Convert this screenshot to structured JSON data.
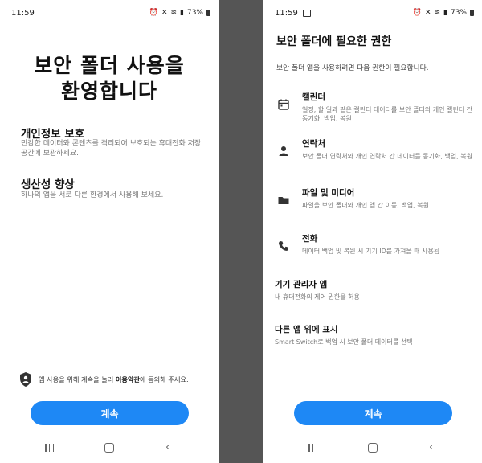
{
  "left": {
    "status": {
      "time": "11:59",
      "battery": "73%"
    },
    "title": "보안 폴더 사용을\n환영합니다",
    "sections": [
      {
        "title": "개인정보 보호",
        "desc": "민감한 데이터와 콘텐츠를 격리되어 보호되는 휴대전화 저장공간에 보관하세요."
      },
      {
        "title": "생산성 향상",
        "desc": "하나의 앱을 서로 다른 환경에서 사용해 보세요."
      }
    ],
    "consent": {
      "prefix": "앱 사용을 위해 계속을 눌러 ",
      "link": "이용약관",
      "suffix": "에 동의해 주세요."
    },
    "continue_label": "계속"
  },
  "right": {
    "status": {
      "time": "11:59",
      "battery": "73%"
    },
    "title": "보안 폴더에 필요한 권한",
    "subtitle": "보안 폴더 앱을 사용하려면 다음 권한이 필요합니다.",
    "permissions": [
      {
        "icon": "calendar-icon",
        "name": "캘린더",
        "desc": "일정, 할 일과 같은 캘린더 데이터를 보안 폴더와 개인 캘린더 간 동기화, 백업, 복원"
      },
      {
        "icon": "contact-icon",
        "name": "연락처",
        "desc": "보안 폴더 연락처와 개인 연락처 간 데이터를 동기화, 백업, 복원"
      },
      {
        "icon": "folder-icon",
        "name": "파일 및 미디어",
        "desc": "파일을 보안 폴더와 개인 앱 간 이동, 백업, 복원"
      },
      {
        "icon": "phone-icon",
        "name": "전화",
        "desc": "데이터 백업 및 복원 시 기기 ID를 가져올 때 사용됨"
      }
    ],
    "extras": [
      {
        "name": "기기 관리자 앱",
        "desc": "내 휴대전화의 제어 권한을 허용"
      },
      {
        "name": "다른 앱 위에 표시",
        "desc": "Smart Switch로 백업 시 보안 폴더 데이터를 선택"
      }
    ],
    "continue_label": "계속"
  }
}
